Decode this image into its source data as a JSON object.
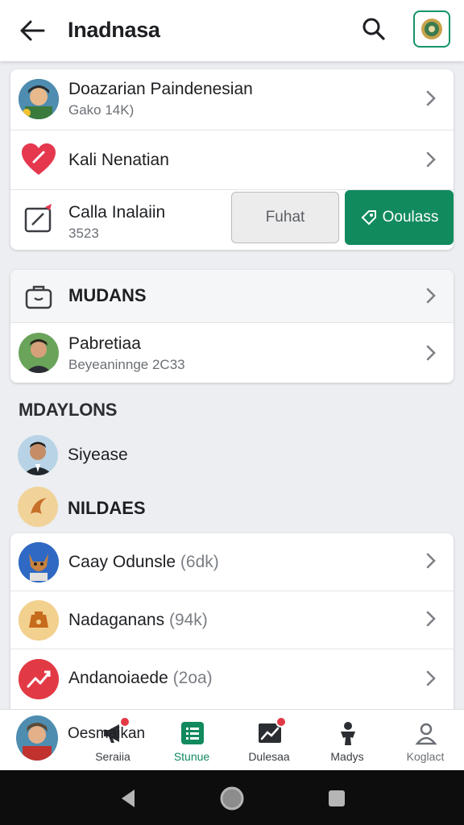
{
  "appbar": {
    "title": "Inadnasa",
    "back_icon": "arrow-left-icon",
    "search_icon": "search-icon",
    "profile_icon": "badge-avatar-icon"
  },
  "card1": {
    "rows": [
      {
        "title": "Doazarian Paindenesian",
        "subtitle": "Gako 14K)",
        "icon": "avatar-man"
      },
      {
        "title": "Kali Nenatian",
        "subtitle": "",
        "icon": "heart-icon"
      },
      {
        "title": "Calla Inalaiin",
        "subtitle": "3523",
        "icon": "edit-frame-icon"
      }
    ],
    "buttons": {
      "secondary": "Fuhat",
      "primary": "Ooulass"
    }
  },
  "card2": {
    "header": "MUDANS",
    "row": {
      "title": "Pabretiaa",
      "subtitle": "Beyeaninnge 2C33",
      "icon": "avatar-man-2"
    }
  },
  "section_mdaylons": {
    "label": "MDAYLONS",
    "item": {
      "title": "Siyease",
      "icon": "avatar-suit"
    }
  },
  "section_nildaes": {
    "label": "NILDAES",
    "icon": "swirl-logo-icon"
  },
  "card3": {
    "rows": [
      {
        "title": "Caay Odunsle",
        "count": "(6dk)",
        "icon": "cat-avatar"
      },
      {
        "title": "Nadaganans",
        "count": "(94k)",
        "icon": "box-avatar"
      },
      {
        "title": "Andanoiaede",
        "count": "(2oa)",
        "icon": "chart-up-icon"
      }
    ]
  },
  "overlay_row": {
    "text": "Oesmaikan"
  },
  "bottom_nav": [
    {
      "label": "Seraiia",
      "icon": "megaphone-icon",
      "badge": true
    },
    {
      "label": "Stunue",
      "icon": "list-icon",
      "active": true
    },
    {
      "label": "Dulesaa",
      "icon": "trend-chart-icon",
      "badge": true
    },
    {
      "label": "Madys",
      "icon": "person-figure-icon"
    },
    {
      "label": "Koglact",
      "icon": "profile-icon"
    }
  ],
  "colors": {
    "accent": "#118a5e",
    "badge": "#e23a45",
    "heart": "#e5384f"
  }
}
